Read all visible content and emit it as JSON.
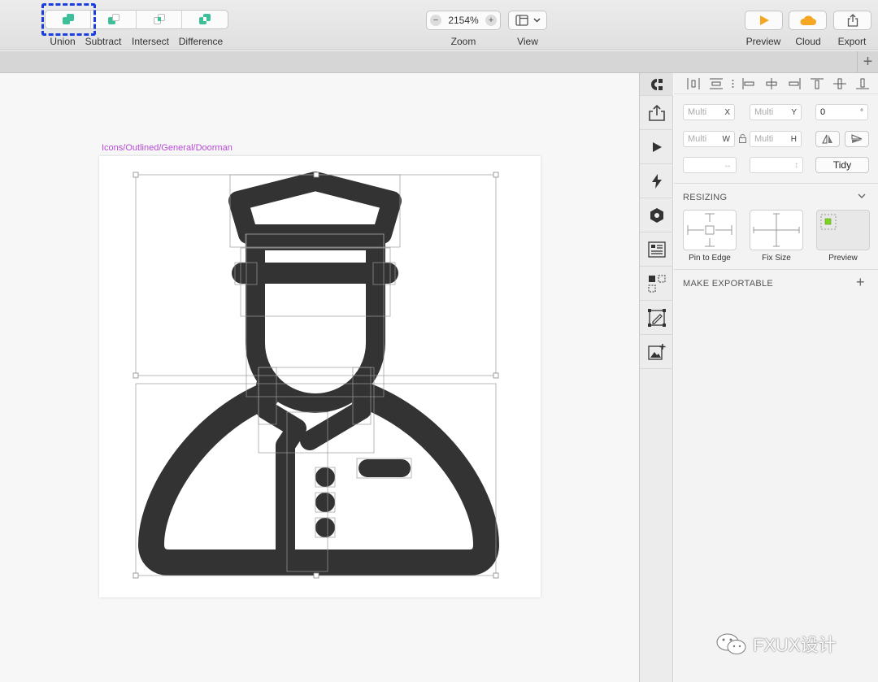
{
  "toolbar": {
    "boolean_ops": [
      {
        "label": "Union"
      },
      {
        "label": "Subtract"
      },
      {
        "label": "Intersect"
      },
      {
        "label": "Difference"
      }
    ],
    "zoom": {
      "label": "Zoom",
      "value": "2154%",
      "minus": "−",
      "plus": "+"
    },
    "view": {
      "label": "View"
    },
    "preview": {
      "label": "Preview"
    },
    "cloud": {
      "label": "Cloud"
    },
    "export": {
      "label": "Export"
    }
  },
  "tabstrip": {
    "add": "+"
  },
  "canvas": {
    "artboard_title": "Icons/Outlined/General/Doorman"
  },
  "inspector": {
    "x": {
      "placeholder": "Multi",
      "label": "X"
    },
    "y": {
      "placeholder": "Multi",
      "label": "Y"
    },
    "rotation": {
      "value": "0",
      "unit": "°"
    },
    "w": {
      "placeholder": "Multi",
      "label": "W"
    },
    "h": {
      "placeholder": "Multi",
      "label": "H"
    },
    "tidy": "Tidy",
    "resizing": {
      "title": "RESIZING",
      "options": [
        {
          "label": "Pin to Edge"
        },
        {
          "label": "Fix Size"
        },
        {
          "label": "Preview"
        }
      ]
    },
    "exportable": {
      "title": "MAKE EXPORTABLE",
      "add": "+"
    }
  },
  "colors": {
    "accent": "#3dbf9a",
    "icon": "#333333",
    "artboard_title": "#b94ad9",
    "highlight": "#1a3fe0",
    "cloud": "#f5a623",
    "preview": "#f5a623"
  },
  "watermark": "FXUX设计"
}
